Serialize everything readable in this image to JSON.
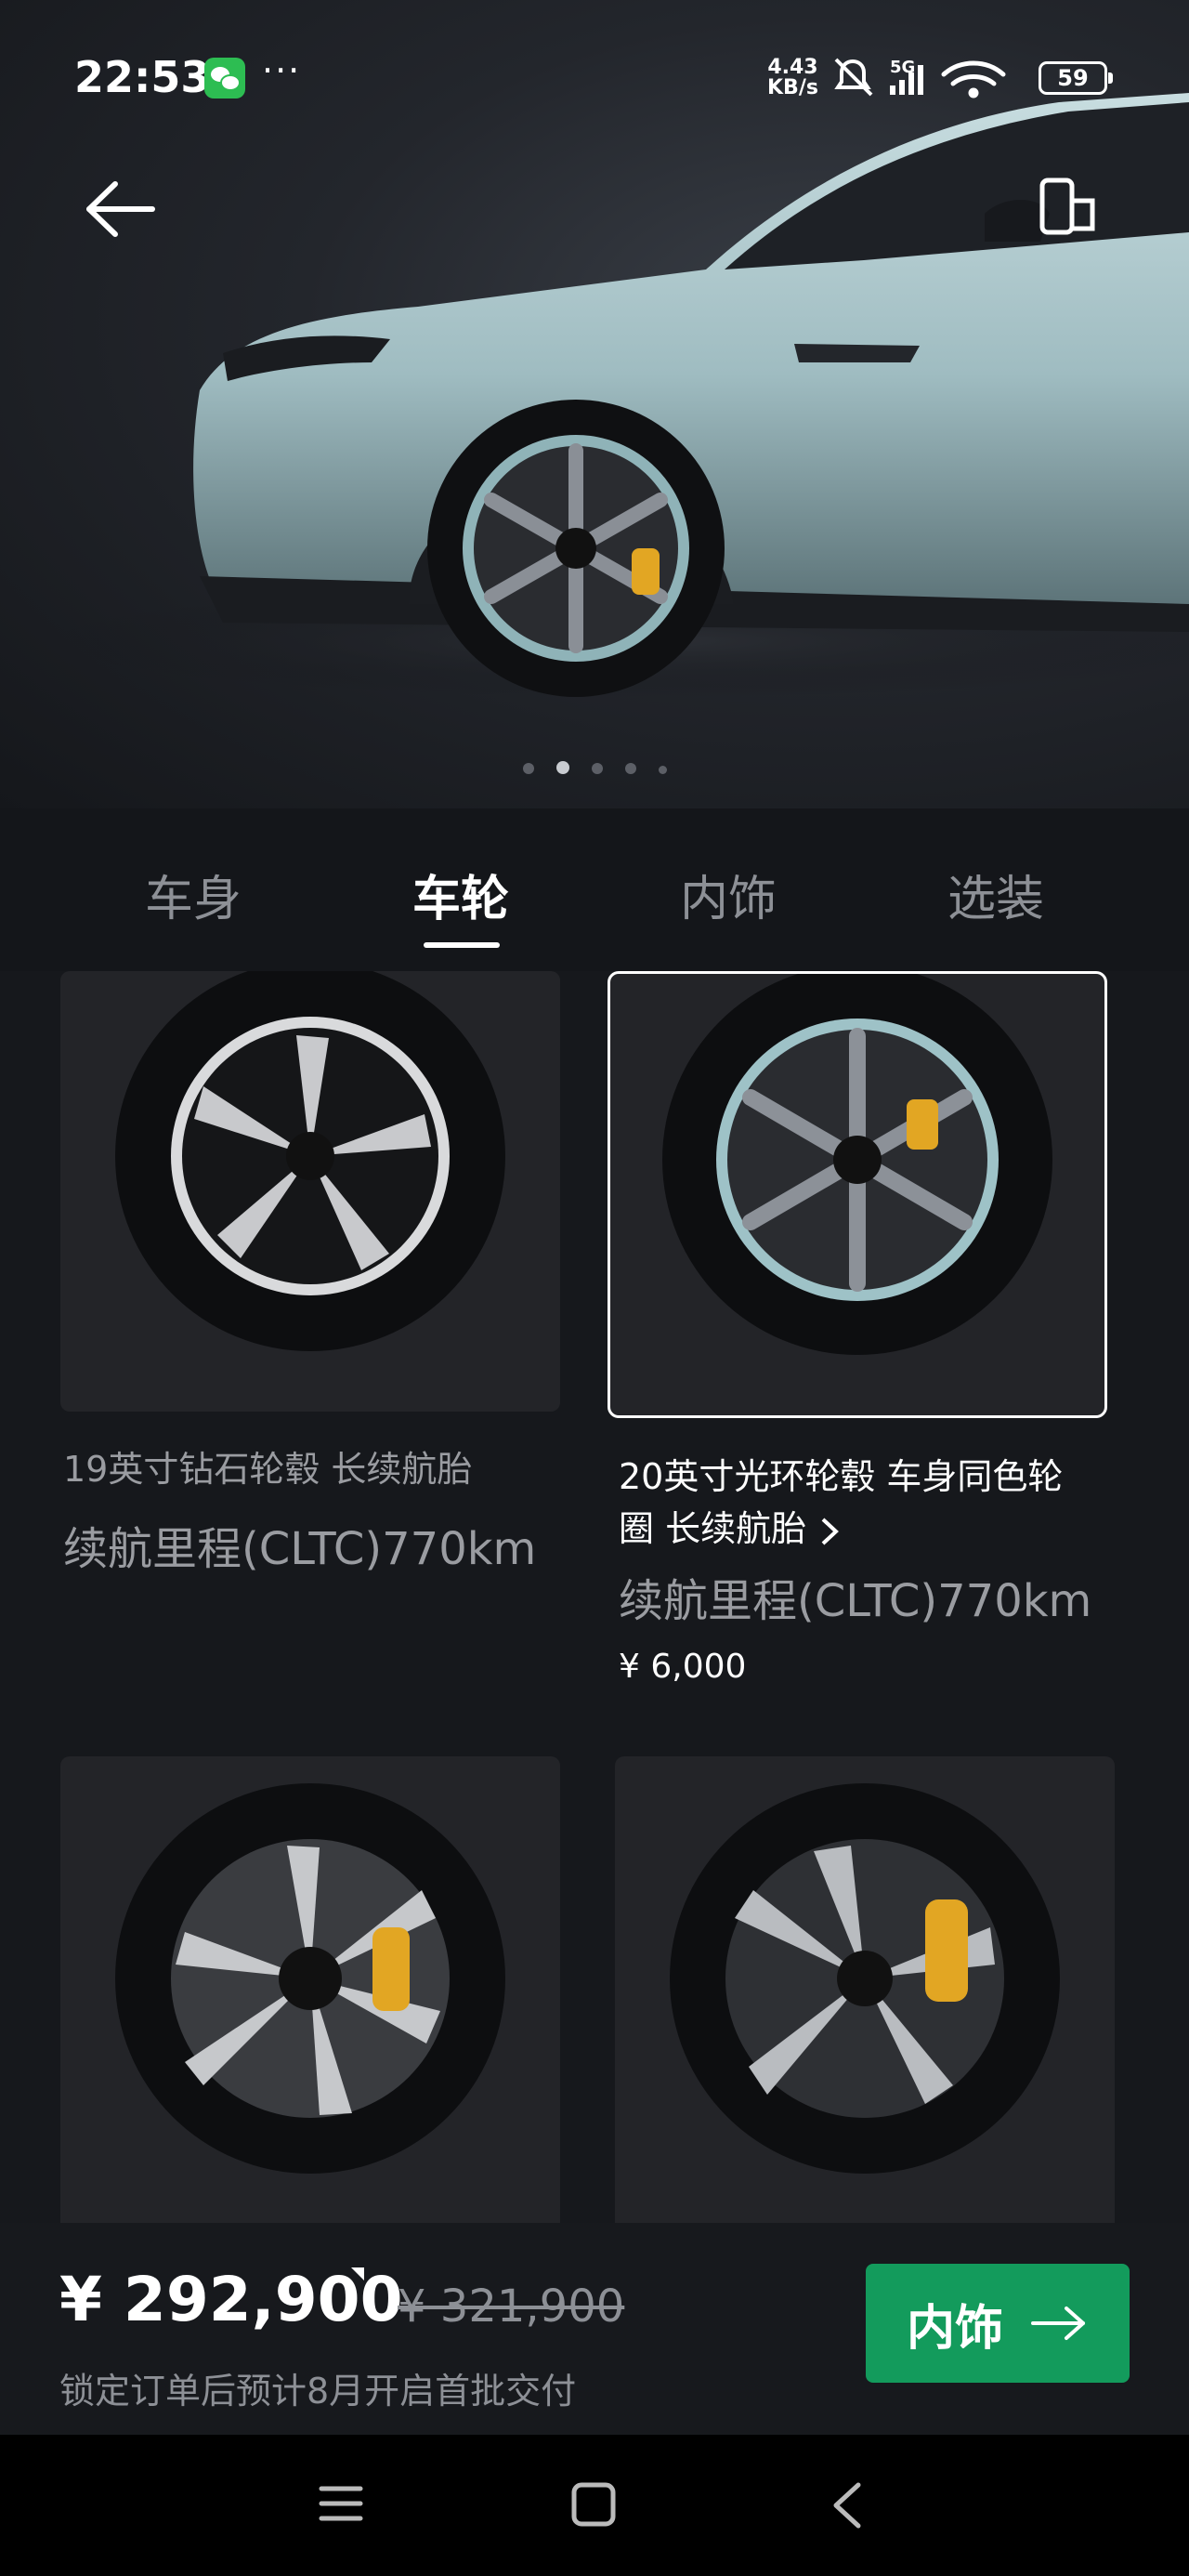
{
  "status_bar": {
    "time": "22:53",
    "net_speed_value": "4.43",
    "net_speed_unit": "KB/s",
    "network": "5G",
    "battery": "59",
    "icons": [
      "wechat-icon",
      "more-dots-icon",
      "mute-icon",
      "signal-icon",
      "wifi-icon",
      "battery-icon"
    ]
  },
  "header": {
    "back_icon": "arrow-left-icon",
    "device_icon": "phone-link-icon"
  },
  "carousel": {
    "count": 5,
    "active_index": 1
  },
  "tabs": [
    {
      "label": "车身"
    },
    {
      "label": "车轮"
    },
    {
      "label": "内饰"
    },
    {
      "label": "选装"
    }
  ],
  "active_tab_index": 1,
  "options": [
    {
      "title": "19英寸钻石轮毂 长续航胎",
      "range": "续航里程(CLTC)770km",
      "price": "",
      "selected": false
    },
    {
      "title_line1": "20英寸光环轮毂 车身同色轮",
      "title_line2": "圈 长续航胎",
      "range": "续航里程(CLTC)770km",
      "price": "¥ 6,000",
      "selected": true
    },
    {
      "selected": false
    },
    {
      "selected": false
    }
  ],
  "summary": {
    "price": "¥ 292,900",
    "original_price": "¥ 321,900",
    "delivery_note": "锁定订单后预计8月开启首批交付",
    "next_label": "内饰",
    "next_icon": "arrow-right-icon"
  },
  "colors": {
    "accent_green": "#139b5c",
    "background": "#16181c",
    "car_paint": "#a9c4c8",
    "caliper": "#e2a623"
  }
}
